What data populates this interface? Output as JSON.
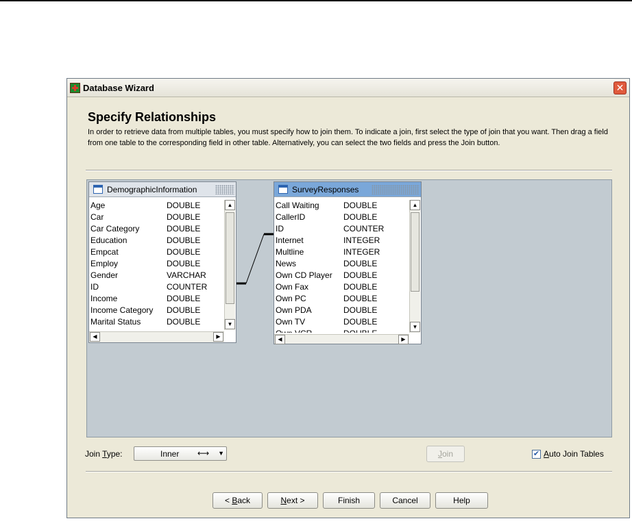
{
  "window": {
    "title": "Database Wizard",
    "close_glyph": "✕"
  },
  "page": {
    "heading": "Specify Relationships",
    "description": "In order to retrieve data from multiple tables, you must specify how to join them. To indicate a join, first select the type of join that you want. Then drag a field from one table to the corresponding field in other table. Alternatively, you can select the two fields and press the Join button."
  },
  "tables": [
    {
      "name": "DemographicInformation",
      "selected": false,
      "fields": [
        {
          "name": "Age",
          "type": "DOUBLE"
        },
        {
          "name": "Car",
          "type": "DOUBLE"
        },
        {
          "name": "Car Category",
          "type": "DOUBLE"
        },
        {
          "name": "Education",
          "type": "DOUBLE"
        },
        {
          "name": "Empcat",
          "type": "DOUBLE"
        },
        {
          "name": "Employ",
          "type": "DOUBLE"
        },
        {
          "name": "Gender",
          "type": "VARCHAR"
        },
        {
          "name": "ID",
          "type": "COUNTER"
        },
        {
          "name": "Income",
          "type": "DOUBLE"
        },
        {
          "name": "Income Category",
          "type": "DOUBLE"
        },
        {
          "name": "Marital Status",
          "type": "DOUBLE"
        }
      ]
    },
    {
      "name": "SurveyResponses",
      "selected": true,
      "fields": [
        {
          "name": "Call Waiting",
          "type": "DOUBLE"
        },
        {
          "name": "CallerID",
          "type": "DOUBLE"
        },
        {
          "name": "ID",
          "type": "COUNTER"
        },
        {
          "name": "Internet",
          "type": "INTEGER"
        },
        {
          "name": "Multline",
          "type": "INTEGER"
        },
        {
          "name": "News",
          "type": "DOUBLE"
        },
        {
          "name": "Own CD Player",
          "type": "DOUBLE"
        },
        {
          "name": "Own Fax",
          "type": "DOUBLE"
        },
        {
          "name": "Own PC",
          "type": "DOUBLE"
        },
        {
          "name": "Own PDA",
          "type": "DOUBLE"
        },
        {
          "name": "Own TV",
          "type": "DOUBLE"
        },
        {
          "name": "Own VCR",
          "type": "DOUBLE"
        }
      ]
    }
  ],
  "join_line": {
    "from": "DemographicInformation.ID",
    "to": "SurveyResponses.ID"
  },
  "controls": {
    "join_type_label_pre": "Join ",
    "join_type_label_key": "T",
    "join_type_label_post": "ype:",
    "join_type_value": "Inner",
    "join_type_symbol": "⟷",
    "join_button_key": "J",
    "join_button_rest": "oin",
    "auto_join_key": "A",
    "auto_join_rest": "uto Join Tables",
    "auto_join_checked": true
  },
  "buttons": {
    "back_pre": "< ",
    "back_key": "B",
    "back_rest": "ack",
    "next_key": "N",
    "next_rest": "ext >",
    "finish": "Finish",
    "cancel": "Cancel",
    "help": "Help"
  },
  "icons": {
    "app": "database-wizard-icon",
    "table": "table-icon",
    "scroll_up": "▲",
    "scroll_down": "▼",
    "scroll_left": "◀",
    "scroll_right": "▶",
    "check": "✔",
    "dropdown": "▼"
  }
}
